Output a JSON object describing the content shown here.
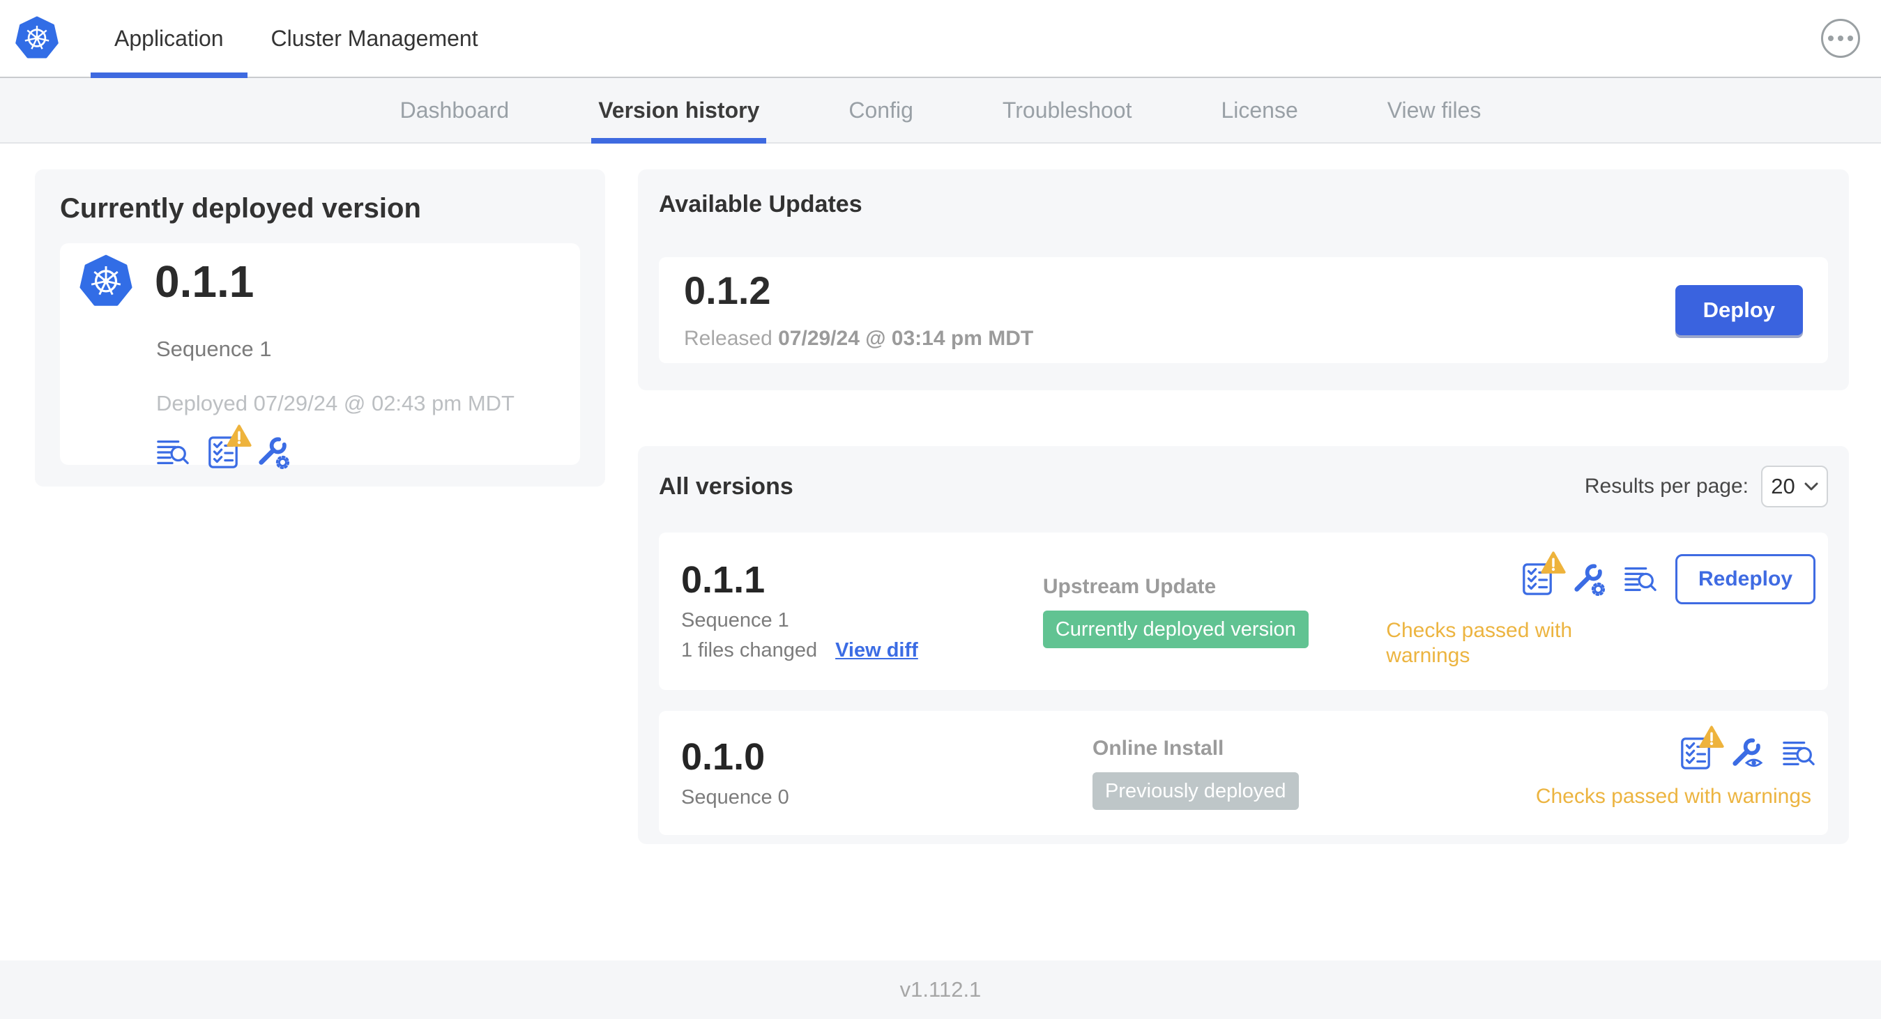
{
  "header": {
    "tabs": [
      {
        "label": "Application"
      },
      {
        "label": "Cluster Management"
      }
    ],
    "active_tab": "Application",
    "more_menu_icon": "ellipsis-icon",
    "logo_icon": "kubernetes-logo"
  },
  "subnav": {
    "tabs": [
      {
        "label": "Dashboard"
      },
      {
        "label": "Version history"
      },
      {
        "label": "Config"
      },
      {
        "label": "Troubleshoot"
      },
      {
        "label": "License"
      },
      {
        "label": "View files"
      }
    ],
    "active_tab": "Version history"
  },
  "deployed": {
    "title": "Currently deployed version",
    "version": "0.1.1",
    "sequence": "Sequence 1",
    "deployed_at": "Deployed 07/29/24 @ 02:43 pm MDT",
    "icons": [
      "diff-search-icon",
      "preflight-checks-warning-icon",
      "edit-config-wrench-gear-icon"
    ]
  },
  "updates": {
    "title": "Available Updates",
    "version": "0.1.2",
    "released_label": "Released",
    "released_at": "07/29/24 @ 03:14 pm MDT",
    "deploy_button": "Deploy"
  },
  "all_versions": {
    "title": "All versions",
    "results_per_page_label": "Results per page:",
    "results_per_page": "20",
    "rows": [
      {
        "version": "0.1.1",
        "sequence": "Sequence 1",
        "files_changed": "1 files changed",
        "diff_link": "View diff",
        "source": "Upstream Update",
        "badge": "Currently deployed version",
        "badge_color": "#61c392",
        "checks_status": "Checks passed with warnings",
        "action_button": "Redeploy",
        "icons": [
          "preflight-checks-warning-icon",
          "edit-config-wrench-gear-icon",
          "diff-search-icon"
        ]
      },
      {
        "version": "0.1.0",
        "sequence": "Sequence 0",
        "source": "Online Install",
        "badge": "Previously deployed",
        "badge_color": "#bec6c8",
        "checks_status": "Checks passed with warnings",
        "icons": [
          "preflight-checks-warning-icon",
          "view-config-wrench-eye-icon",
          "diff-search-icon"
        ]
      }
    ]
  },
  "footer": {
    "app_version": "v1.112.1"
  },
  "colors": {
    "accent_blue": "#3b6ce4",
    "deploy_button_blue": "#3a63df",
    "success_green": "#61c392",
    "muted_badge_gray": "#bec6c8",
    "warning_amber": "#ecb440",
    "k8s_logo_blue": "#326de6",
    "subnav_bg": "#f5f6f8",
    "panel_bg": "#f6f7f9"
  }
}
